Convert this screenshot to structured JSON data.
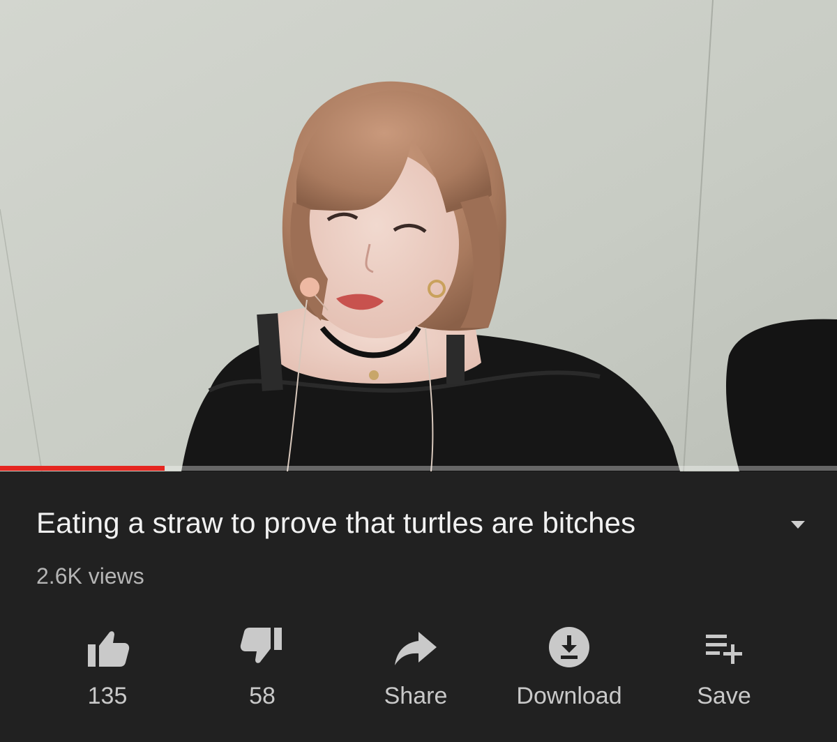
{
  "video": {
    "progress_fraction": 0.197
  },
  "title": "Eating a straw to prove that turtles are bitches",
  "views": "2.6K views",
  "actions": [
    {
      "icon": "thumbs-up-icon",
      "label": "135"
    },
    {
      "icon": "thumbs-down-icon",
      "label": "58"
    },
    {
      "icon": "share-arrow-icon",
      "label": "Share"
    },
    {
      "icon": "download-icon",
      "label": "Download"
    },
    {
      "icon": "playlist-add-icon",
      "label": "Save"
    }
  ],
  "colors": {
    "background": "#212121",
    "progress": "#e52620",
    "icon": "#c9c9c9",
    "title": "#f1f1f1"
  }
}
